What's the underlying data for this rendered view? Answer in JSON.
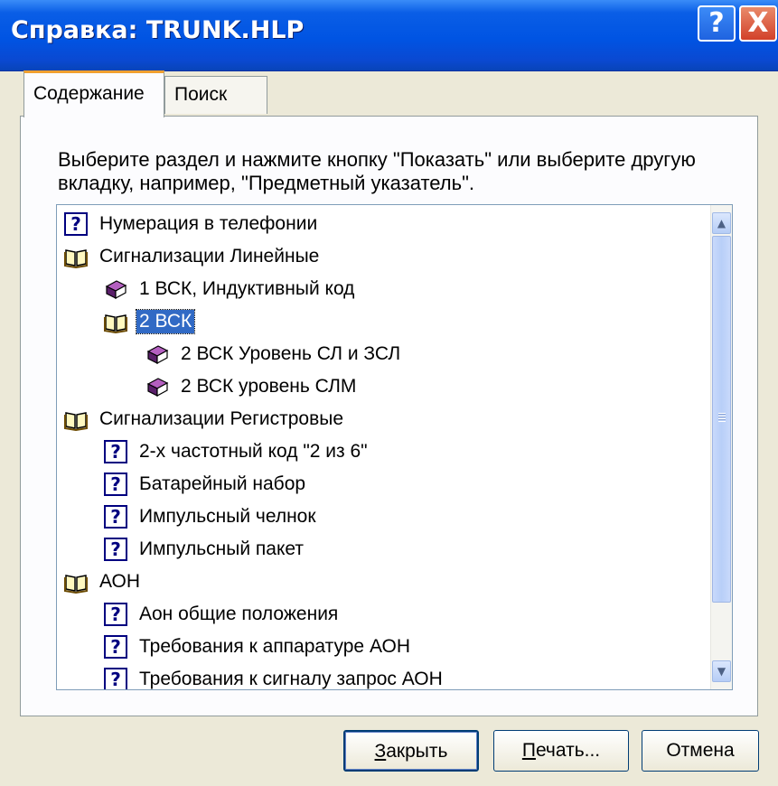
{
  "window": {
    "title": "Справка: TRUNK.HLP",
    "help_button": "?",
    "close_button": "X"
  },
  "tabs": [
    {
      "label": "Содержание"
    },
    {
      "label": "Поиск"
    }
  ],
  "instructions": "Выберите раздел и нажмите кнопку \"Показать\" или выберите другую вкладку, например, \"Предметный указатель\".",
  "tree": {
    "items": [
      {
        "label": "Нумерация в телефонии",
        "icon": "help-topic-icon"
      },
      {
        "label": "Сигнализации  Линейные",
        "icon": "open-book-icon"
      },
      {
        "label": "1 ВСК, Индуктивный код",
        "icon": "closed-book-icon"
      },
      {
        "label": "2 ВСК",
        "icon": "open-book-icon",
        "selected": true
      },
      {
        "label": "2 ВСК Уровень СЛ и ЗСЛ",
        "icon": "closed-book-icon"
      },
      {
        "label": "2 ВСК уровень СЛМ",
        "icon": "closed-book-icon"
      },
      {
        "label": "Сигнализации Регистровые",
        "icon": "open-book-icon"
      },
      {
        "label": "2-х частотный код \"2 из 6\"",
        "icon": "help-topic-icon"
      },
      {
        "label": "Батарейный набор",
        "icon": "help-topic-icon"
      },
      {
        "label": "Импульсный челнок",
        "icon": "help-topic-icon"
      },
      {
        "label": "Импульсный пакет",
        "icon": "help-topic-icon"
      },
      {
        "label": "АОН",
        "icon": "open-book-icon"
      },
      {
        "label": "Аон общие положения",
        "icon": "help-topic-icon"
      },
      {
        "label": "Требования к аппаратуре АОН",
        "icon": "help-topic-icon"
      },
      {
        "label": "Требования к сигналу запрос АОН",
        "icon": "help-topic-icon"
      }
    ]
  },
  "buttons": {
    "close": {
      "accel": "З",
      "rest": "акрыть"
    },
    "print": {
      "accel": "П",
      "rest": "ечать..."
    },
    "cancel": "Отмена"
  },
  "colors": {
    "title_bar": "#0054e3",
    "selection": "#316ac5",
    "dialog_bg": "#ece9d8"
  }
}
